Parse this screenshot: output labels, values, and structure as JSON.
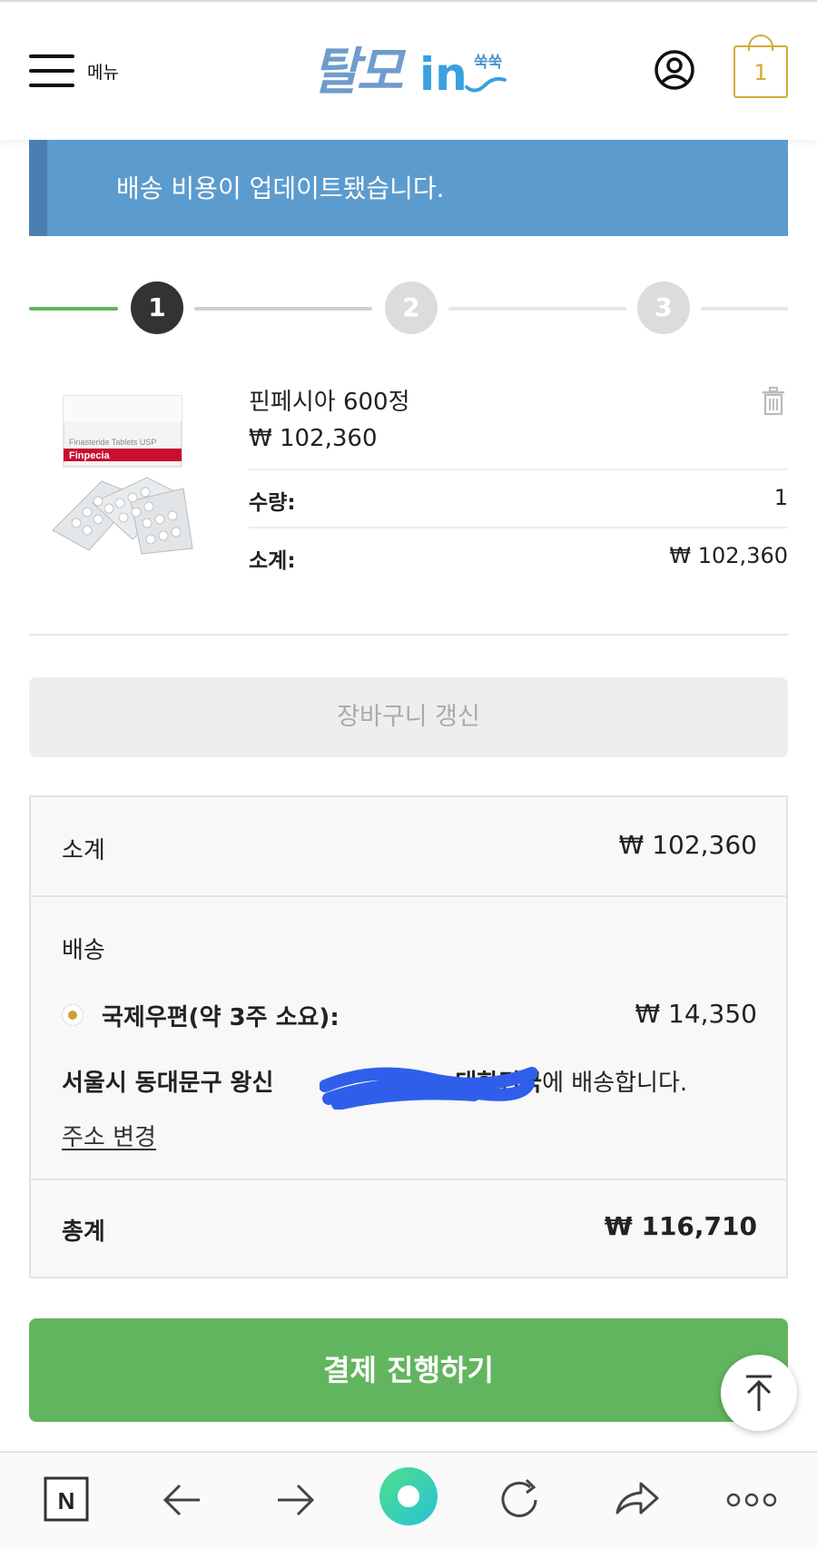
{
  "header": {
    "menu_label": "메뉴",
    "logo_main": "탈모",
    "logo_in": "in",
    "logo_sub": "쑥쑥",
    "cart_count": "1"
  },
  "notice": {
    "text": "배송 비용이 업데이트됐습니다."
  },
  "steps": [
    {
      "label": "1",
      "state": "active"
    },
    {
      "label": "2",
      "state": "inactive"
    },
    {
      "label": "3",
      "state": "inactive"
    }
  ],
  "product": {
    "name": "핀페시아 600정",
    "price": "₩ 102,360",
    "quantity_label": "수량:",
    "quantity": "1",
    "subtotal_label": "소계:",
    "subtotal": "₩ 102,360",
    "box_text": "Finasteride Tablets USP",
    "box_brand": "Finpecia"
  },
  "update_cart_label": "장바구니 갱신",
  "totals": {
    "subtotal_label": "소계",
    "subtotal": "₩ 102,360",
    "shipping_label": "배송",
    "shipping_method": "국제우편(약 3주 소요):",
    "shipping_price": "₩ 14,350",
    "address_bold_1": "서울시 동대문구 왕신",
    "address_bold_2": "대한민국",
    "address_suffix": "에 배송합니다.",
    "change_address": "주소 변경",
    "total_label": "총계",
    "total": "₩ 116,710"
  },
  "checkout_label": "결제 진행하기",
  "colors": {
    "accent_green": "#62b55f",
    "notice_blue": "#5c9bce",
    "gold": "#d4a93a"
  },
  "toolbar": {
    "icons": [
      "naver-icon",
      "back-arrow-icon",
      "forward-arrow-icon",
      "home-circle-icon",
      "refresh-icon",
      "share-icon",
      "more-icon"
    ],
    "naver_letter": "N"
  }
}
